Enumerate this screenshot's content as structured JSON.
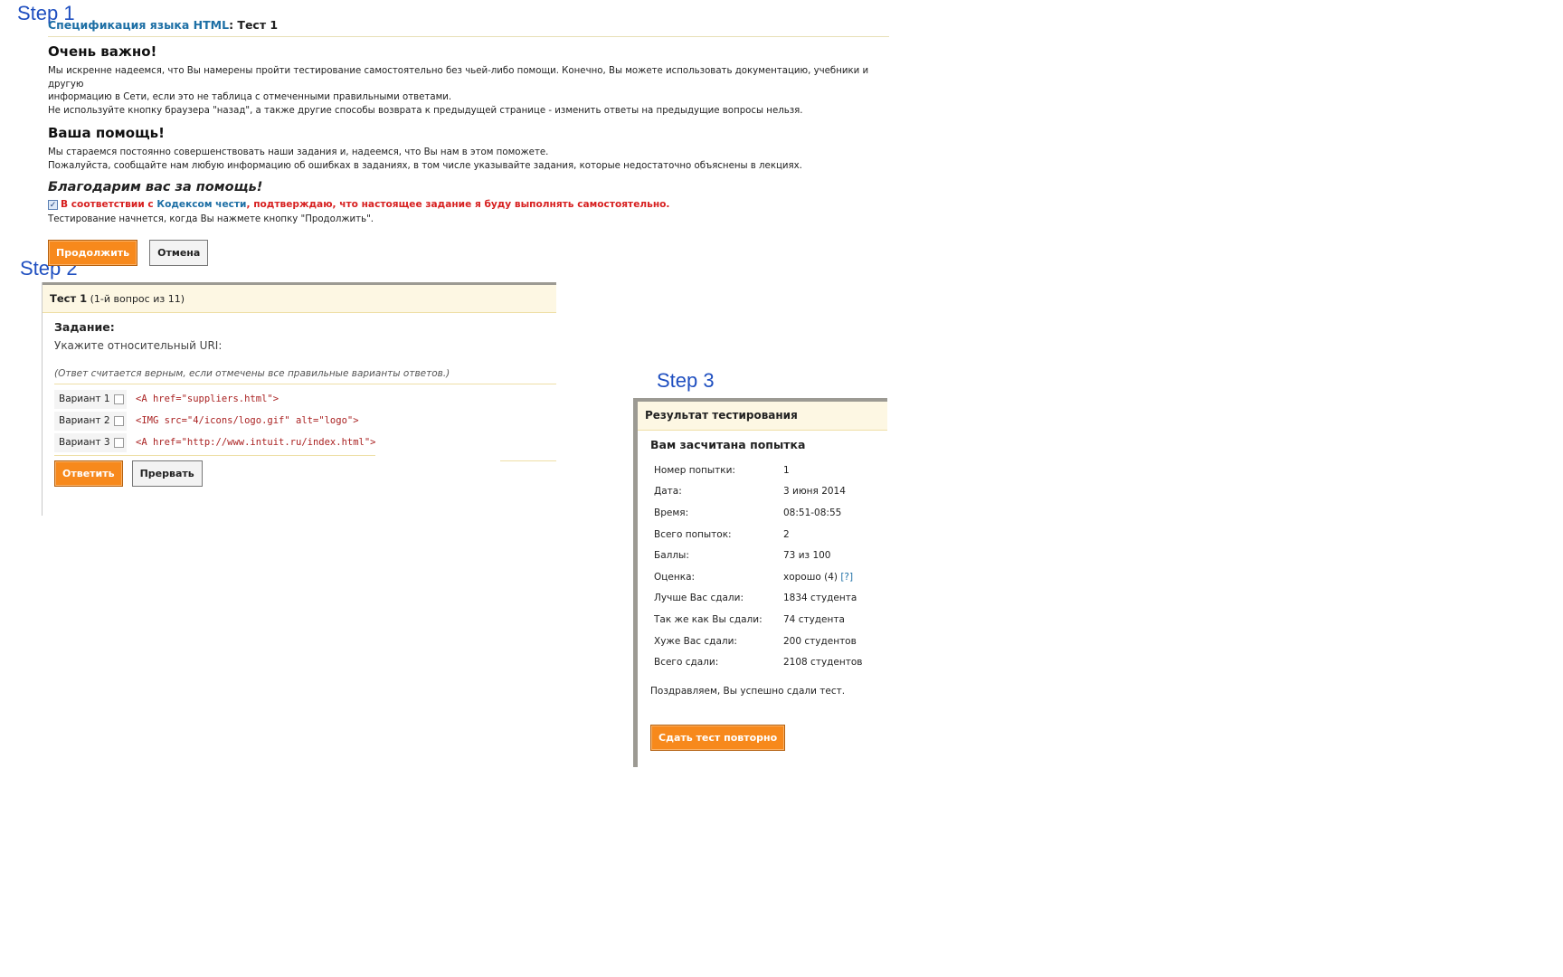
{
  "labels": {
    "step1": "Step 1",
    "step2": "Step 2",
    "step3": "Step 3"
  },
  "step1": {
    "breadcrumb_link": "Спецификация языка HTML",
    "breadcrumb_rest": ": Тест 1",
    "important_title": "Очень важно!",
    "important_lines": [
      "Мы искренне надеемся, что Вы намерены пройти тестирование самостоятельно без чьей-либо помощи. Конечно, Вы можете использовать документацию, учебники и другую",
      "информацию в Сети, если это не таблица с отмеченными правильными ответами.",
      "Не используйте кнопку браузера \"назад\", а также другие способы возврата к предыдущей странице - изменить ответы на предыдущие вопросы нельзя."
    ],
    "help_title": "Ваша помощь!",
    "help_lines": [
      "Мы стараемся постоянно совершенствовать наши задания и, надеемся, что Вы нам в этом поможете.",
      "Пожалуйста, сообщайте нам любую информацию об ошибках в заданиях, в том числе указывайте задания, которые недостаточно объяснены в лекциях."
    ],
    "thanks_title": "Благодарим вас за помощь!",
    "honor_before": "В соответствии с ",
    "honor_link": "Кодексом чести",
    "honor_after": ", подтверждаю, что настоящее задание я буду выполнять самостоятельно.",
    "start_note": "Тестирование начнется, когда Вы нажмете кнопку \"Продолжить\".",
    "continue_label": "Продолжить",
    "cancel_label": "Отмена"
  },
  "step2": {
    "test_title": "Тест 1",
    "test_progress": "(1-й вопрос из 11)",
    "task_label": "Задание:",
    "task_text": "Укажите относительный URI:",
    "note": "(Ответ считается верным, если отмечены все правильные варианты ответов.)",
    "options": [
      {
        "label": "Вариант 1",
        "code": "<A href=\"suppliers.html\">"
      },
      {
        "label": "Вариант 2",
        "code": "<IMG src=\"4/icons/logo.gif\" alt=\"logo\">"
      },
      {
        "label": "Вариант 3",
        "code": "<A href=\"http://www.intuit.ru/index.html\">"
      }
    ],
    "answer_label": "Ответить",
    "abort_label": "Прервать"
  },
  "step3": {
    "header": "Результат тестирования",
    "subtitle": "Вам засчитана попытка",
    "rows": [
      {
        "k": "Номер попытки:",
        "v": "1"
      },
      {
        "k": "Дата:",
        "v": "3 июня 2014"
      },
      {
        "k": "Время:",
        "v": "08:51-08:55"
      },
      {
        "k": "Всего попыток:",
        "v": "2"
      },
      {
        "k": "Баллы:",
        "v": "73 из 100"
      },
      {
        "k": "Оценка:",
        "v": "хорошо (4)",
        "link": "[?]"
      },
      {
        "k": "Лучше Вас сдали:",
        "v": "1834 студента"
      },
      {
        "k": "Так же как Вы сдали:",
        "v": "74 студента"
      },
      {
        "k": "Хуже Вас сдали:",
        "v": "200 студентов"
      },
      {
        "k": "Всего сдали:",
        "v": "2108 студентов"
      }
    ],
    "congrats": "Поздравляем, Вы успешно сдали тест.",
    "retry_label": "Сдать тест повторно"
  }
}
